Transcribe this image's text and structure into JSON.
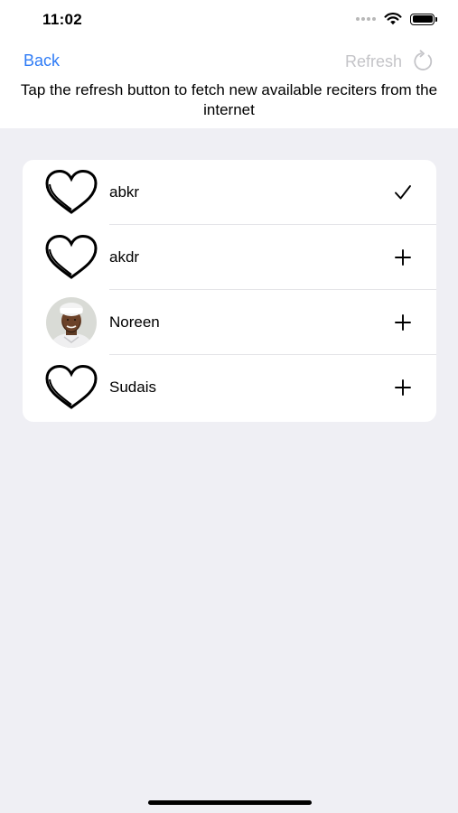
{
  "status_bar": {
    "time": "11:02"
  },
  "nav": {
    "back_label": "Back",
    "refresh_label": "Refresh"
  },
  "instruction": "Tap the refresh button to fetch new available reciters from the internet",
  "reciters": [
    {
      "name": "abkr",
      "image": "heart-icon",
      "action": "checkmark-icon"
    },
    {
      "name": "akdr",
      "image": "heart-icon",
      "action": "plus-icon"
    },
    {
      "name": "Noreen",
      "image": "photo",
      "action": "plus-icon"
    },
    {
      "name": "Sudais",
      "image": "heart-icon",
      "action": "plus-icon"
    }
  ],
  "colors": {
    "accent": "#2f7cf6",
    "disabled": "#c4c4c8",
    "background": "#efeff4"
  }
}
